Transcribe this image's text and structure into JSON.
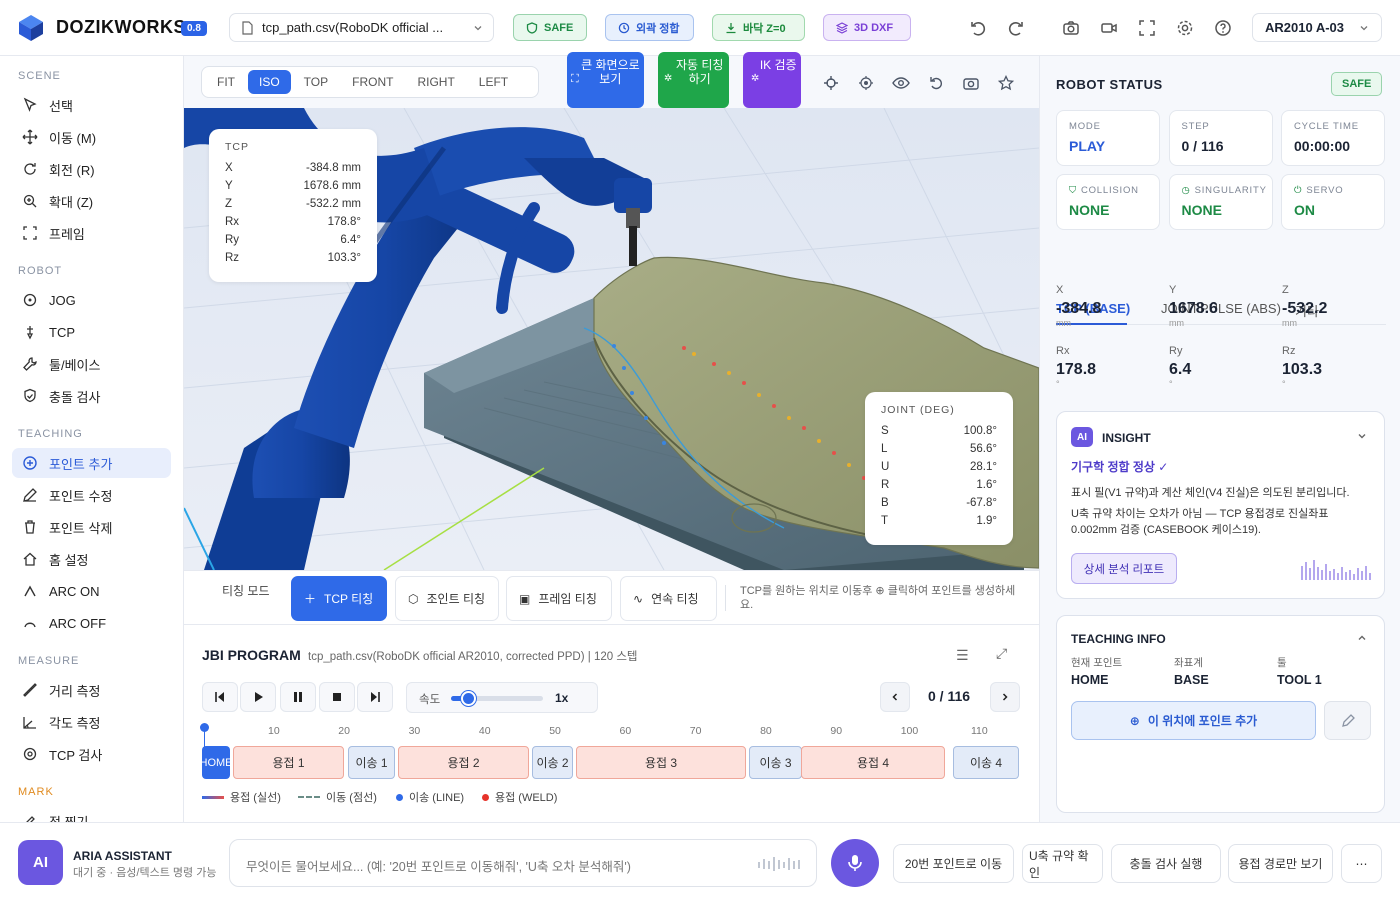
{
  "app": {
    "brand": "DOZIKWORKS",
    "version": "0.8",
    "file": "tcp_path.csv(RoboDK official ...",
    "robot": "AR2010 A-03"
  },
  "topbar": {
    "pills": [
      {
        "label": "SAFE",
        "icon": "shield-icon",
        "bg": "#e9f8ee",
        "border": "#9ad3ad",
        "fg": "#1d8a45"
      },
      {
        "label": "외곽 정합",
        "icon": "clock-icon",
        "bg": "#e8f0fd",
        "border": "#a9c3ef",
        "fg": "#2a5bd1"
      },
      {
        "label": "바닥 Z=0",
        "icon": "download-icon",
        "bg": "#eaf8ed",
        "border": "#a1d9ae",
        "fg": "#1c8a3d"
      },
      {
        "label": "3D DXF",
        "icon": "layers-icon",
        "bg": "#f2ebfd",
        "border": "#c9b2f0",
        "fg": "#7a3fd6"
      }
    ]
  },
  "sidebar": {
    "scene_label": "SCENE",
    "scene": [
      "선택",
      "이동 (M)",
      "회전 (R)",
      "확대 (Z)",
      "프레임"
    ],
    "robot_label": "ROBOT",
    "robot": [
      "JOG",
      "TCP",
      "툴/베이스",
      "충돌 검사"
    ],
    "teaching_label": "TEACHING",
    "teaching": [
      "포인트 추가",
      "포인트 수정",
      "포인트 삭제",
      "홈 설정",
      "ARC ON",
      "ARC OFF"
    ],
    "measure_label": "MEASURE",
    "measure": [
      "거리 측정",
      "각도 측정",
      "TCP 검사"
    ],
    "mark_label": "MARK",
    "mark": [
      "점 찍기"
    ]
  },
  "viewtoolbar": {
    "views": [
      "FIT",
      "ISO",
      "TOP",
      "FRONT",
      "RIGHT",
      "LEFT"
    ],
    "active": "ISO",
    "big_buttons": [
      "큰 화면으로 보기",
      "자동 티칭 하기",
      "IK 검증"
    ]
  },
  "tcp_card": {
    "title": "TCP",
    "rows": [
      {
        "k": "X",
        "v": "-384.8 mm"
      },
      {
        "k": "Y",
        "v": "1678.6 mm"
      },
      {
        "k": "Z",
        "v": "-532.2 mm"
      },
      {
        "k": "Rx",
        "v": "178.8°"
      },
      {
        "k": "Ry",
        "v": "6.4°"
      },
      {
        "k": "Rz",
        "v": "103.3°"
      }
    ]
  },
  "joint_card": {
    "title": "JOINT (DEG)",
    "rows": [
      {
        "k": "S",
        "v": "100.8°"
      },
      {
        "k": "L",
        "v": "56.6°"
      },
      {
        "k": "U",
        "v": "28.1°"
      },
      {
        "k": "R",
        "v": "1.6°"
      },
      {
        "k": "B",
        "v": "-67.8°"
      },
      {
        "k": "T",
        "v": "1.9°"
      }
    ]
  },
  "teachbar": {
    "mode": "티칭 모드",
    "buttons": [
      "TCP 티칭",
      "조인트 티칭",
      "프레임 티칭",
      "연속 티칭"
    ],
    "hint": "TCP를 원하는 위치로 이동후 ⊕ 클릭하여 포인트를 생성하세요."
  },
  "jbi": {
    "title": "JBI PROGRAM",
    "subtitle": "tcp_path.csv(RoboDK official AR2010, corrected PPD) | 120 스텝",
    "speed_label": "속도",
    "speed_value": "1x",
    "speed_fraction": 0.18,
    "step": "0 / 116",
    "ticks": [
      "10",
      "20",
      "30",
      "40",
      "50",
      "60",
      "70",
      "80",
      "90",
      "100",
      "110"
    ],
    "segments": [
      {
        "label": "HOME",
        "type": "home"
      },
      {
        "label": "용접 1",
        "type": "weld"
      },
      {
        "label": "이송 1",
        "type": "move"
      },
      {
        "label": "용접 2",
        "type": "weld"
      },
      {
        "label": "이송 2",
        "type": "move"
      },
      {
        "label": "용접 3",
        "type": "weld"
      },
      {
        "label": "이송 3",
        "type": "move"
      },
      {
        "label": "용접 4",
        "type": "weld"
      },
      {
        "label": "이송 4",
        "type": "move"
      }
    ],
    "legend": [
      "용접 (실선)",
      "이동 (점선)",
      "이송 (LINE)",
      "용접 (WELD)"
    ]
  },
  "status": {
    "title": "ROBOT STATUS",
    "badge": "SAFE",
    "cards": [
      {
        "label": "MODE",
        "value": "PLAY",
        "color": "#2b5bd7"
      },
      {
        "label": "STEP",
        "value": "0 / 116",
        "color": "#1b2333"
      },
      {
        "label": "CYCLE TIME",
        "value": "00:00:00",
        "color": "#1b2333"
      },
      {
        "label": "COLLISION",
        "value": "NONE",
        "color": "#1d8a45"
      },
      {
        "label": "SINGULARITY",
        "value": "NONE",
        "color": "#1d8a45"
      },
      {
        "label": "SERVO",
        "value": "ON",
        "color": "#1d8a45"
      }
    ],
    "tabs": [
      "TCP (BASE)",
      "JOINT",
      "PULSE (ABS)",
      "기타"
    ],
    "coords": [
      {
        "k": "X",
        "v": "-384.8",
        "u": "mm"
      },
      {
        "k": "Y",
        "v": "1678.6",
        "u": "mm"
      },
      {
        "k": "Z",
        "v": "-532.2",
        "u": "mm"
      },
      {
        "k": "Rx",
        "v": "178.8",
        "u": "°"
      },
      {
        "k": "Ry",
        "v": "6.4",
        "u": "°"
      },
      {
        "k": "Rz",
        "v": "103.3",
        "u": "°"
      }
    ]
  },
  "insight": {
    "title": "INSIGHT",
    "badge": "AI",
    "status": "기구학 정합 정상 ✓",
    "text1": "표시 필(V1 규약)과 계산 체인(V4 진실)은 의도된 분리입니다.",
    "text2": "U축 규약 차이는 오차가 아님 — TCP 용접경로 진실좌표 0.002mm 검증 (CASEBOOK 케이스19).",
    "button": "상세 분석 리포트"
  },
  "teaching_info": {
    "title": "TEACHING INFO",
    "cols": [
      {
        "k": "현재 포인트",
        "v": "HOME"
      },
      {
        "k": "좌표계",
        "v": "BASE"
      },
      {
        "k": "툴",
        "v": "TOOL 1"
      }
    ],
    "add_button": "이 위치에 포인트 추가"
  },
  "chat": {
    "avatar": "AI",
    "name": "ARIA ASSISTANT",
    "status": "대기 중 · 음성/텍스트 명령 가능",
    "placeholder": "무엇이든 물어보세요... (예: '20번 포인트로 이동해줘', 'U축 오차 분석해줘')",
    "quick": [
      "20번 포인트로 이동",
      "U축 규약 확인",
      "충돌 검사 실행",
      "용접 경로만 보기",
      "⋯"
    ]
  }
}
